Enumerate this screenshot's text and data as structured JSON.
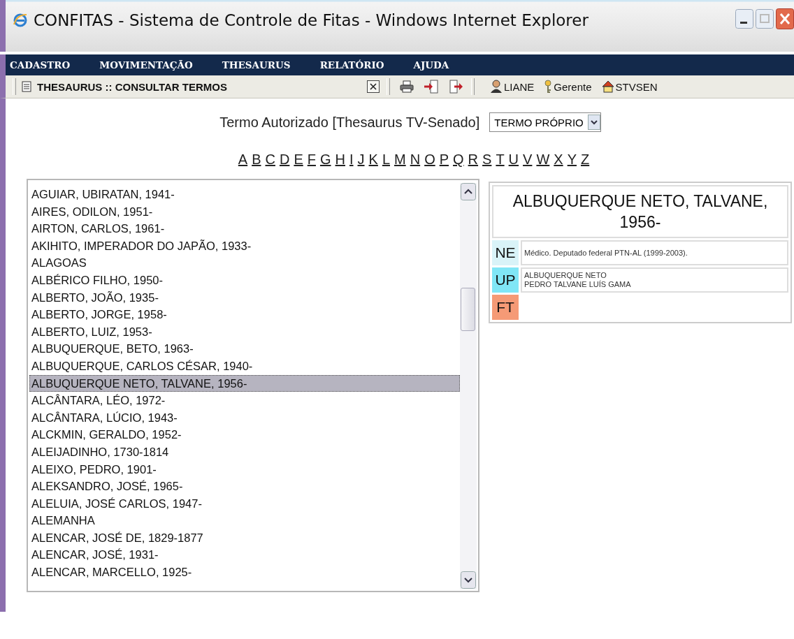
{
  "window": {
    "title": "CONFITAS - Sistema de Controle de Fitas - Windows Internet Explorer"
  },
  "menu": [
    "CADASTRO",
    "MOVIMENTAÇÃO",
    "THESAURUS",
    "RELATÓRIO",
    "AJUDA"
  ],
  "toolbar": {
    "page_title": "THESAURUS :: CONSULTAR TERMOS",
    "user": "LIANE",
    "role": "Gerente",
    "unit": "STVSEN"
  },
  "filter": {
    "label": "Termo Autorizado [Thesaurus TV-Senado]",
    "select_value": "TERMO PRÓPRIO"
  },
  "alphabet": [
    "A",
    "B",
    "C",
    "D",
    "E",
    "F",
    "G",
    "H",
    "I",
    "J",
    "K",
    "L",
    "M",
    "N",
    "O",
    "P",
    "Q",
    "R",
    "S",
    "T",
    "U",
    "V",
    "W",
    "X",
    "Y",
    "Z"
  ],
  "terms": [
    {
      "label": "AGUIAR, UBIRATAN, 1941-",
      "selected": false
    },
    {
      "label": "AIRES, ODILON, 1951-",
      "selected": false
    },
    {
      "label": "AIRTON, CARLOS, 1961-",
      "selected": false
    },
    {
      "label": "AKIHITO, IMPERADOR DO JAPÃO, 1933-",
      "selected": false
    },
    {
      "label": "ALAGOAS",
      "selected": false
    },
    {
      "label": "ALBÉRICO FILHO, 1950-",
      "selected": false
    },
    {
      "label": "ALBERTO, JOÃO, 1935-",
      "selected": false
    },
    {
      "label": "ALBERTO, JORGE, 1958-",
      "selected": false
    },
    {
      "label": "ALBERTO, LUIZ, 1953-",
      "selected": false
    },
    {
      "label": "ALBUQUERQUE, BETO, 1963-",
      "selected": false
    },
    {
      "label": "ALBUQUERQUE, CARLOS CÉSAR, 1940-",
      "selected": false
    },
    {
      "label": "ALBUQUERQUE NETO, TALVANE, 1956-",
      "selected": true
    },
    {
      "label": "ALCÂNTARA, LÉO, 1972-",
      "selected": false
    },
    {
      "label": "ALCÂNTARA, LÚCIO, 1943-",
      "selected": false
    },
    {
      "label": "ALCKMIN, GERALDO, 1952-",
      "selected": false
    },
    {
      "label": "ALEIJADINHO, 1730-1814",
      "selected": false
    },
    {
      "label": "ALEIXO, PEDRO, 1901-",
      "selected": false
    },
    {
      "label": "ALEKSANDRO, JOSÉ, 1965-",
      "selected": false
    },
    {
      "label": "ALELUIA, JOSÉ CARLOS, 1947-",
      "selected": false
    },
    {
      "label": "ALEMANHA",
      "selected": false
    },
    {
      "label": "ALENCAR, JOSÉ DE, 1829-1877",
      "selected": false
    },
    {
      "label": "ALENCAR, JOSÉ, 1931-",
      "selected": false
    },
    {
      "label": "ALENCAR, MARCELLO, 1925-",
      "selected": false
    }
  ],
  "detail": {
    "heading": "ALBUQUERQUE NETO, TALVANE, 1956-",
    "fields": [
      {
        "code": "NE",
        "color": "#d9f3f8",
        "lines": [
          "Médico. Deputado federal PTN-AL (1999-2003)."
        ]
      },
      {
        "code": "UP",
        "color": "#80e6f6",
        "lines": [
          "ALBUQUERQUE NETO",
          "PEDRO TALVANE LUÍS GAMA"
        ]
      },
      {
        "code": "FT",
        "color": "#f59a76"
      }
    ]
  }
}
